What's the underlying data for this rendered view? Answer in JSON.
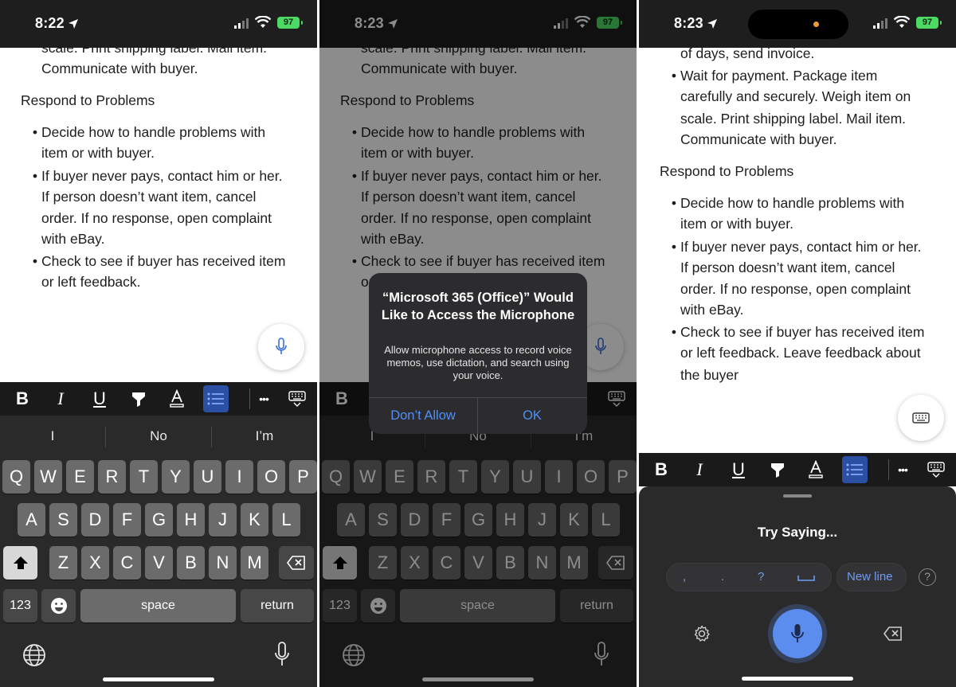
{
  "status": {
    "time_1": "8:22",
    "time_2": "8:23",
    "time_3": "8:23",
    "battery": "97"
  },
  "document": {
    "cut_line": "scale. Print shipping label. Mail item.",
    "communicate": "Communicate with buyer.",
    "heading": "Respond to Problems",
    "bullet1_l1": "Decide how to handle problems with",
    "bullet1_l2": "item or with buyer.",
    "bullet2_l1": "If buyer never pays, contact him or her.",
    "bullet2_l2": "If person doesn’t want item, cancel",
    "bullet2_l3": "order. If no response, open complaint",
    "bullet2_l4": "with eBay.",
    "bullet3_l1": "Check to see if buyer has received item",
    "bullet3_l2": "or left feedback.",
    "p3_top": "of days, send invoice.",
    "p3_wait_l1": "Wait for payment. Package item",
    "p3_wait_l2": "carefully and securely. Weigh item on",
    "p3_wait_l3": "scale. Print shipping label. Mail item.",
    "p3_bullet3_l2": "or left feedback. Leave feedback about",
    "p3_bullet3_l3": "the buyer"
  },
  "toolbar": {
    "bold": "B",
    "italic": "I",
    "underline": "U",
    "more": "•••"
  },
  "keyboard": {
    "suggestions": [
      "I",
      "No",
      "I’m"
    ],
    "row1": [
      "Q",
      "W",
      "E",
      "R",
      "T",
      "Y",
      "U",
      "I",
      "O",
      "P"
    ],
    "row2": [
      "A",
      "S",
      "D",
      "F",
      "G",
      "H",
      "J",
      "K",
      "L"
    ],
    "row3": [
      "Z",
      "X",
      "C",
      "V",
      "B",
      "N",
      "M"
    ],
    "numbers": "123",
    "space": "space",
    "return": "return"
  },
  "alert": {
    "title": "“Microsoft 365 (Office)” Would Like to Access the Microphone",
    "message": "Allow microphone access to record voice memos, use dictation, and search using your voice.",
    "deny": "Don’t Allow",
    "ok": "OK"
  },
  "dictation": {
    "try_saying": "Try Saying...",
    "chips": [
      ",",
      ".",
      "?"
    ],
    "new_line": "New line",
    "help": "?"
  },
  "colors": {
    "accent_blue": "#4f8ff7",
    "mic_blue": "#5b8def",
    "active_format": "#2b4fa3",
    "battery_green": "#4cd964"
  }
}
